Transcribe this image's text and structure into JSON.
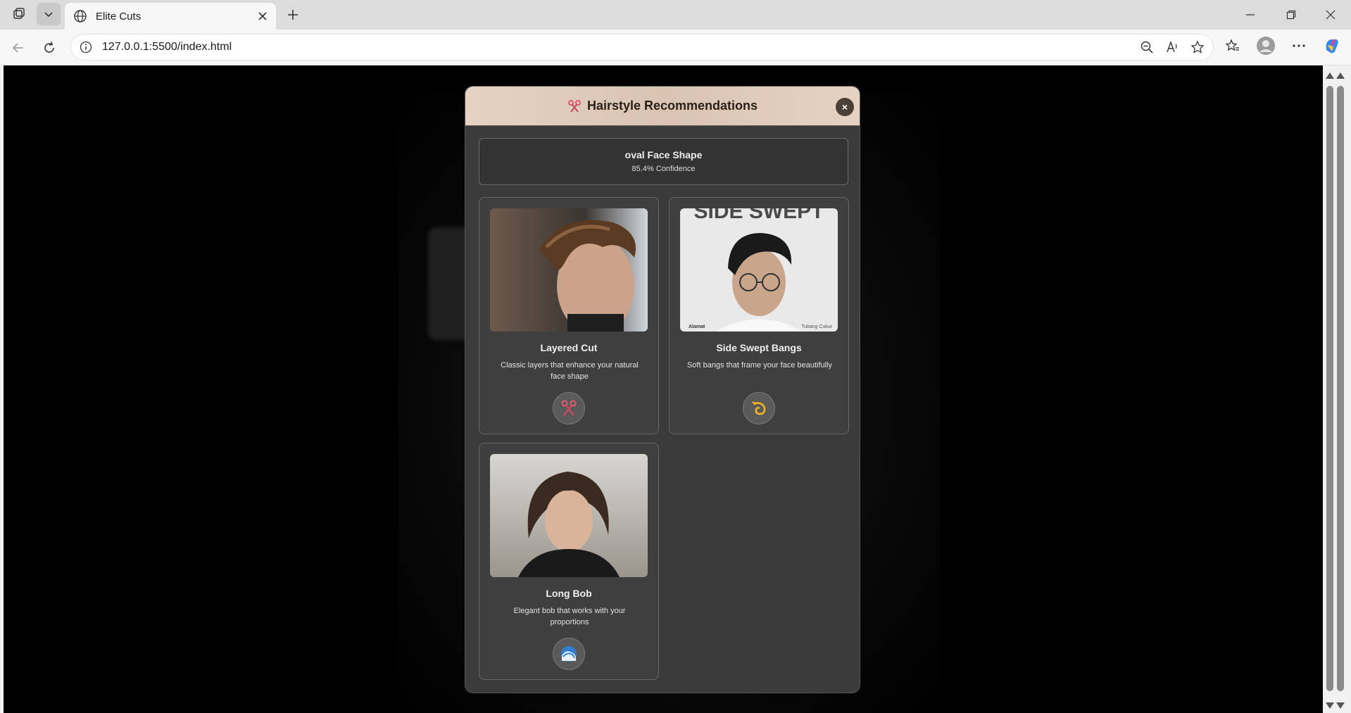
{
  "browser": {
    "tab_title": "Elite Cuts",
    "url": "127.0.0.1:5500/index.html"
  },
  "modal": {
    "title": "Hairstyle Recommendations",
    "close_label": "×",
    "face_shape": "oval Face Shape",
    "confidence": "85.4% Confidence",
    "cards": [
      {
        "name": "Layered Cut",
        "description": "Classic layers that enhance your natural face shape",
        "icon": "scissors-icon"
      },
      {
        "name": "Side Swept Bangs",
        "description": "Soft bangs that frame your face beautifully",
        "icon": "swirl-icon"
      },
      {
        "name": "Long Bob",
        "description": "Elegant bob that works with your proportions",
        "icon": "wave-icon"
      }
    ],
    "photo_text": {
      "banner": "SIDE SWEPT",
      "left_caption": "Alamat",
      "right_caption": "Tukang Cukur"
    }
  },
  "colors": {
    "header_gradient": "#e6d2c3",
    "modal_bg": "#3b3b3b",
    "accent_icon": "#f0b429",
    "scissors": "#e05a6a"
  }
}
